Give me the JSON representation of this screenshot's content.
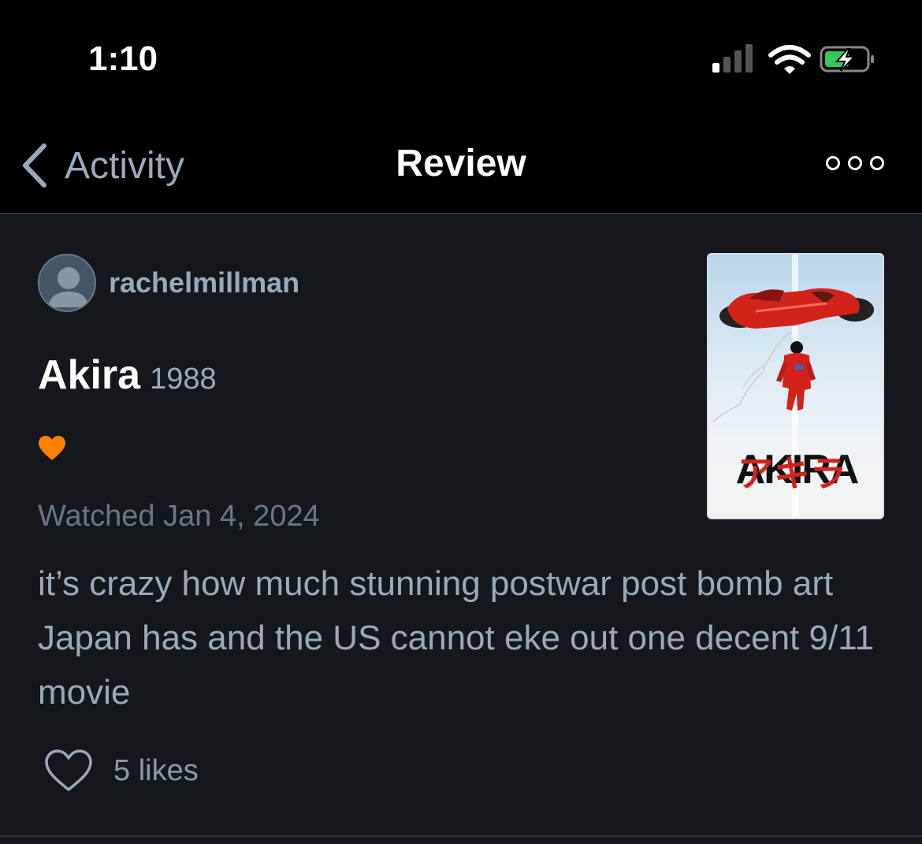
{
  "status_bar": {
    "time": "1:10"
  },
  "nav": {
    "back_label": "Activity",
    "title": "Review"
  },
  "review": {
    "username": "rachelmillman",
    "film_title": "Akira",
    "film_year": "1988",
    "liked": true,
    "watched_date": "Watched Jan 4, 2024",
    "text": "it’s crazy how much stunning postwar post bomb art Japan has and the US cannot eke out one decent 9/11 movie",
    "likes": "5 likes"
  },
  "poster": {
    "title_text": "AKIRA",
    "katakana": "アキラ"
  },
  "colors": {
    "accent_heart": "#ff8000",
    "background": "#14181c",
    "muted_text": "#99aabb"
  }
}
